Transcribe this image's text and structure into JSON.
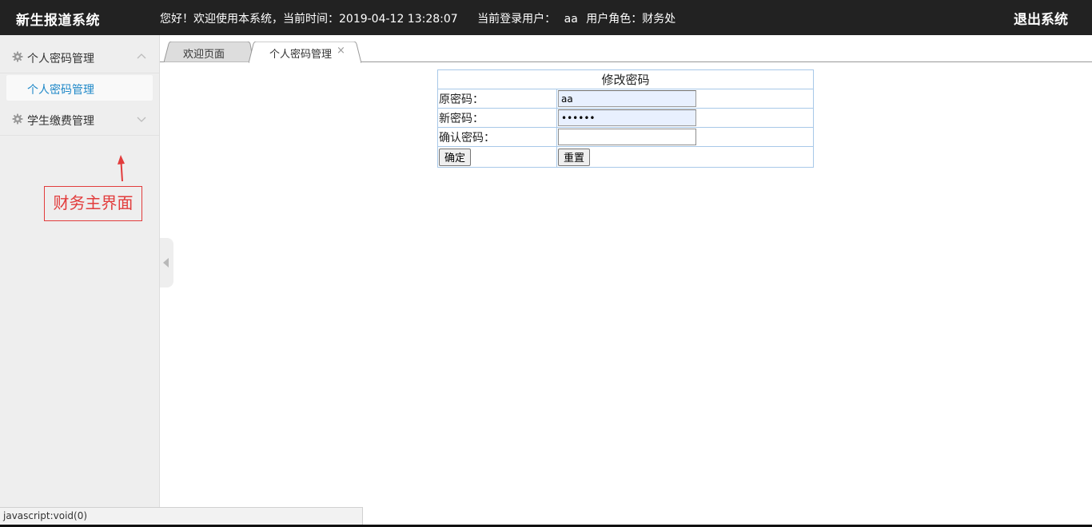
{
  "header": {
    "brand": "新生报道系统",
    "welcome": "您好！欢迎使用本系统，当前时间：",
    "datetime": "2019-04-12 13:28:07",
    "user_label": "当前登录用户：",
    "username": "aa",
    "role_label": "用户角色：",
    "role": "财务处",
    "logout": "退出系统"
  },
  "sidebar": {
    "groups": [
      {
        "label": "个人密码管理",
        "icon": "gear-icon",
        "expanded": true,
        "items": [
          {
            "label": "个人密码管理"
          }
        ]
      },
      {
        "label": "学生缴费管理",
        "icon": "gear-icon",
        "expanded": false,
        "items": []
      }
    ]
  },
  "annotation": {
    "text": "财务主界面",
    "color": "#e23c3c"
  },
  "tabs": [
    {
      "label": "欢迎页面",
      "active": false
    },
    {
      "label": "个人密码管理",
      "active": true,
      "close": "×"
    }
  ],
  "form": {
    "title": "修改密码",
    "old_password_label": "原密码：",
    "old_password_value": "aa",
    "new_password_label": "新密码：",
    "new_password_value": "••••••",
    "confirm_password_label": "确认密码：",
    "confirm_password_value": "",
    "submit": "确定",
    "reset": "重置"
  },
  "status_bar": {
    "text": "javascript:void(0)"
  },
  "colors": {
    "header_bg": "#222222",
    "sidebar_bg": "#eeeeee",
    "link_blue": "#1e88c8",
    "table_border": "#a8c8e8",
    "autofill_bg": "#e8f0fe"
  }
}
